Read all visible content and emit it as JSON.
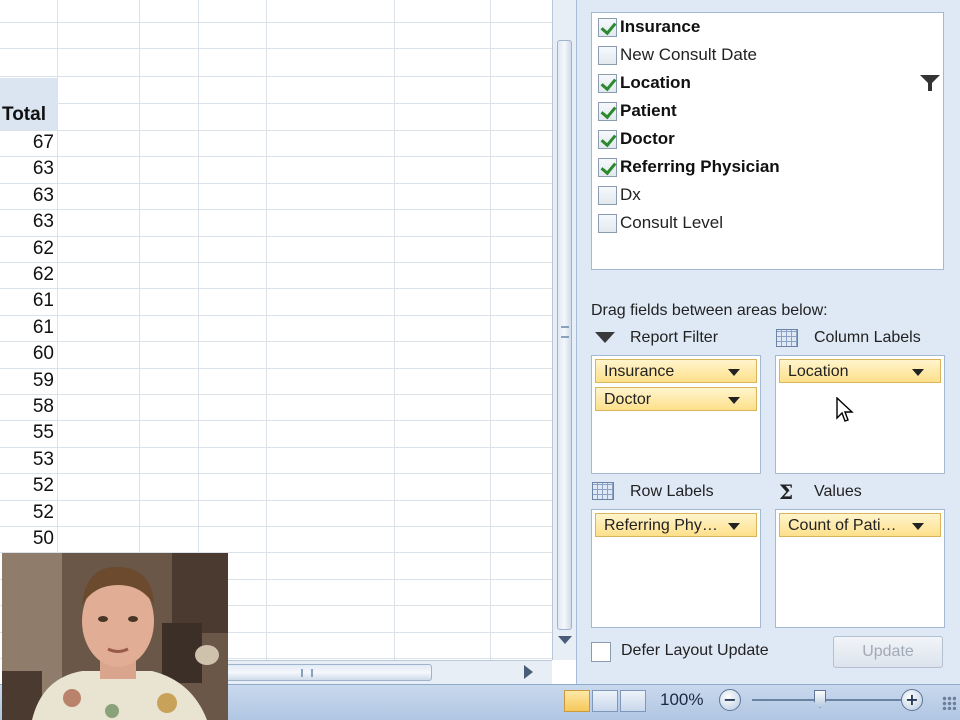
{
  "sheet": {
    "total_header": "Total",
    "totals": [
      "67",
      "63",
      "63",
      "63",
      "62",
      "62",
      "61",
      "61",
      "60",
      "59",
      "58",
      "55",
      "53",
      "52",
      "52",
      "50"
    ]
  },
  "pivot": {
    "fields": [
      {
        "label": "Insurance",
        "checked": true
      },
      {
        "label": "New Consult Date",
        "checked": false
      },
      {
        "label": "Location",
        "checked": true
      },
      {
        "label": "Patient",
        "checked": true
      },
      {
        "label": "Doctor",
        "checked": true
      },
      {
        "label": "Referring Physician",
        "checked": true
      },
      {
        "label": "Dx",
        "checked": false
      },
      {
        "label": "Consult Level",
        "checked": false
      }
    ],
    "drag_instruction": "Drag fields between areas below:",
    "areas": {
      "report_filter": {
        "title": "Report Filter",
        "items": [
          "Insurance",
          "Doctor"
        ],
        "icon": "funnel-icon"
      },
      "column_labels": {
        "title": "Column Labels",
        "items": [
          "Location"
        ],
        "icon": "grid-icon"
      },
      "row_labels": {
        "title": "Row Labels",
        "items": [
          "Referring Phy…"
        ],
        "icon": "grid-icon"
      },
      "values": {
        "title": "Values",
        "items": [
          "Count of Pati…"
        ],
        "icon": "sigma-icon"
      }
    },
    "defer_label": "Defer Layout Update",
    "update_label": "Update"
  },
  "statusbar": {
    "zoom": "100%",
    "zoom_minus": "−",
    "zoom_plus": "+"
  },
  "colors": {
    "pill_fill": "#fde08a",
    "pane_bg": "#dfe9f5",
    "checkmark": "#2b8a2b"
  }
}
